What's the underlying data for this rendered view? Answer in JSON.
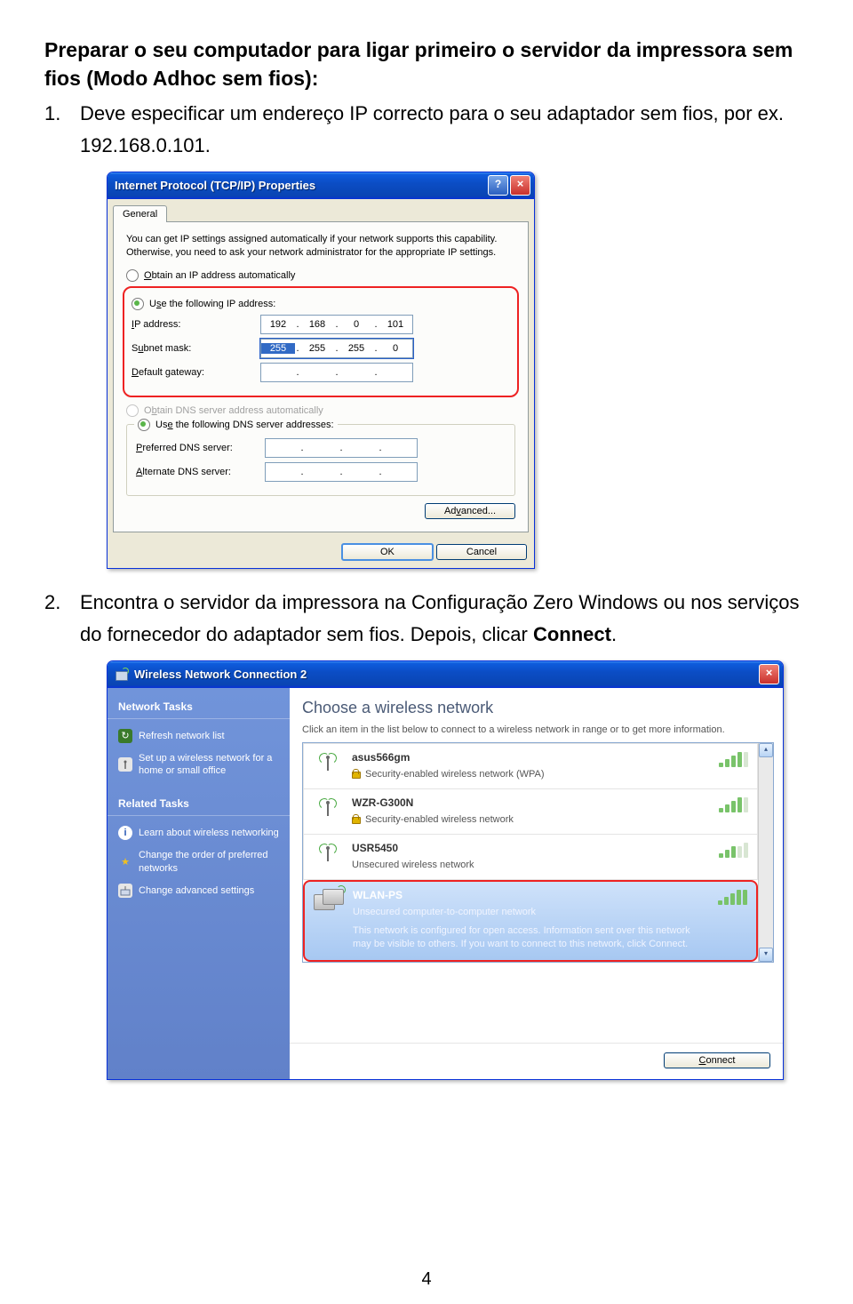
{
  "heading": "Preparar o seu computador para ligar primeiro o servidor da impressora sem fios (Modo Adhoc sem fios):",
  "step1": {
    "num": "1.",
    "text": "Deve especificar um endereço IP correcto para o seu adaptador sem fios, por ex. 192.168.0.101."
  },
  "step2": {
    "num": "2.",
    "text": "Encontra o servidor da impressora na Configuração Zero Windows ou nos serviços do fornecedor do adaptador sem fios. Depois, clicar ",
    "bold": "Connect",
    "suffix": "."
  },
  "ipDialog": {
    "title": "Internet Protocol (TCP/IP) Properties",
    "tab": "General",
    "desc": "You can get IP settings assigned automatically if your network supports this capability. Otherwise, you need to ask your network administrator for the appropriate IP settings.",
    "optAuto": "Obtain an IP address automatically",
    "optUse": "Use the following IP address:",
    "ipLabel": "IP address:",
    "subnetLabel": "Subnet mask:",
    "gatewayLabel": "Default gateway:",
    "ip": [
      "192",
      "168",
      "0",
      "101"
    ],
    "subnet": [
      "255",
      "255",
      "255",
      "0"
    ],
    "optDnsAuto": "Obtain DNS server address automatically",
    "optDnsUse": "Use the following DNS server addresses:",
    "prefDns": "Preferred DNS server:",
    "altDns": "Alternate DNS server:",
    "advanced": "Advanced...",
    "ok": "OK",
    "cancel": "Cancel"
  },
  "wifi": {
    "title": "Wireless Network Connection 2",
    "sideNetTasks": "Network Tasks",
    "refresh": "Refresh network list",
    "setup": "Set up a wireless network for a home or small office",
    "sideRelated": "Related Tasks",
    "learn": "Learn about wireless networking",
    "changeOrder": "Change the order of preferred networks",
    "changeAdv": "Change advanced settings",
    "choose": "Choose a wireless network",
    "sub": "Click an item in the list below to connect to a wireless network in range or to get more information.",
    "net1": {
      "name": "asus566gm",
      "sec": "Security-enabled wireless network (WPA)"
    },
    "net2": {
      "name": "WZR-G300N",
      "sec": "Security-enabled wireless network"
    },
    "net3": {
      "name": "USR5450",
      "sec": "Unsecured wireless network"
    },
    "net4": {
      "name": "WLAN-PS",
      "sec": "Unsecured computer-to-computer network",
      "note": "This network is configured for open access. Information sent over this network may be visible to others. If you want to connect to this network, click Connect."
    },
    "connect": "Connect"
  },
  "pageNum": "4"
}
